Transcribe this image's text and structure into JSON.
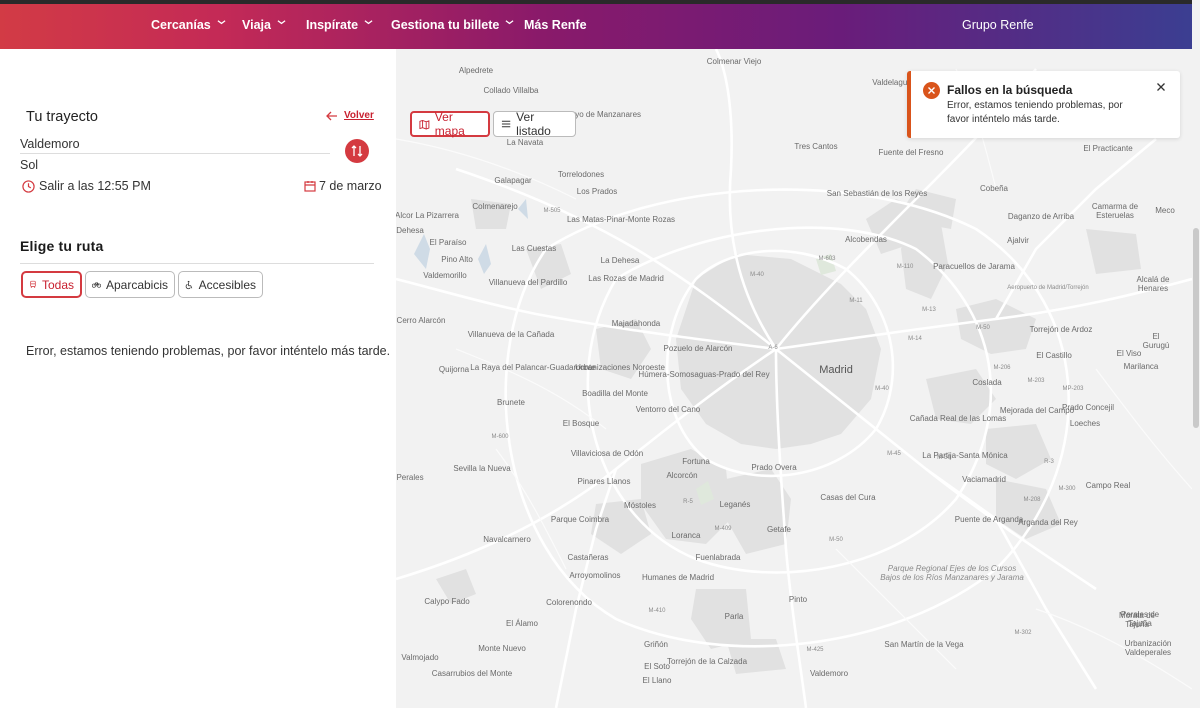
{
  "header": {
    "nav": [
      {
        "label": "Cercanías",
        "chevron": true
      },
      {
        "label": "Viaja",
        "chevron": true
      },
      {
        "label": "Inspírate",
        "chevron": true
      },
      {
        "label": "Gestiona tu billete",
        "chevron": true
      },
      {
        "label": "Más Renfe",
        "chevron": false
      }
    ],
    "right_link": "Grupo Renfe"
  },
  "journey": {
    "title": "Tu trayecto",
    "back_label": "Volver",
    "origin": "Valdemoro",
    "destination": "Sol",
    "departure": "Salir a las 12:55 PM",
    "date": "7 de marzo"
  },
  "routes": {
    "title": "Elige tu ruta",
    "filters": [
      {
        "label": "Todas",
        "active": true,
        "icon": "train-icon"
      },
      {
        "label": "Aparcabicis",
        "active": false,
        "icon": "bicycle-icon"
      },
      {
        "label": "Accesibles",
        "active": false,
        "icon": "wheelchair-icon"
      }
    ],
    "error": "Error, estamos teniendo problemas, por favor inténtelo más tarde."
  },
  "map": {
    "view_map": "Ver mapa",
    "view_list": "Ver listado",
    "places": [
      "Alpedrete",
      "Collado Villalba",
      "Hoyo de Manzanares",
      "Colmenar Viejo",
      "Valdelagua",
      "Tres Cantos",
      "La Navata",
      "Galapagar",
      "Torrelodones",
      "Los Prados",
      "Colmenarejo",
      "Fuente del Fresno",
      "El Practicante",
      "Cobeña",
      "San Sebastián de los Reyes",
      "Alcobendas",
      "Camarma de Esteruelas",
      "Meco",
      "Daganzo de Arriba",
      "Ajalvir",
      "Alcor La Pizarrera",
      "Dehesa",
      "El Paraíso",
      "Las Matas-Pinar-Monte Rozas",
      "Las Cuestas",
      "Pino Alto",
      "La Dehesa",
      "Paracuellos de Jarama",
      "Aeropuerto de Madrid/Torrejón",
      "Alcalá de Henares",
      "Valdemorillo",
      "Villanueva del Pardillo",
      "Las Rozas de Madrid",
      "Cerro Alarcón",
      "Villanueva de la Cañada",
      "Majadahonda",
      "Torrejón de Ardoz",
      "El Gurugú",
      "Pozuelo de Alarcón",
      "El Castillo",
      "El Viso",
      "Marilanca",
      "Quijorna",
      "La Raya del Palancar-Guadamonte",
      "Urbanizaciones Noroeste",
      "Húmera-Somosaguas-Prado del Rey",
      "Madrid",
      "Coslada",
      "Boadilla del Monte",
      "Brunete",
      "Ventorro del Cano",
      "El Bosque",
      "Cañada Real de las Lomas",
      "Mejorada del Campo",
      "Prado Concejil",
      "Loeches",
      "Villaviciosa de Odón",
      "Fortuna",
      "La Partija-Santa Mónica",
      "Sevilla la Nueva",
      "Perales",
      "Pinares Llanos",
      "Alcorcón",
      "Prado Overa",
      "Vaciamadrid",
      "Campo Real",
      "Casas del Cura",
      "Móstoles",
      "Leganés",
      "Parque Coimbra",
      "Getafe",
      "Puente de Arganda",
      "Arganda del Rey",
      "Navalcarnero",
      "Loranca",
      "Fuenlabrada",
      "Castañeras",
      "Arroyomolinos",
      "Humanes de Madrid",
      "Parque Regional Ejes de los Cursos Bajos de los Ríos Manzanares y Jarama",
      "Calypo Fado",
      "Colorenondo",
      "Pinto",
      "Morata de Tajuña",
      "El Álamo",
      "Parla",
      "Perales de Tajuña",
      "Griñón",
      "San Martín de la Vega",
      "Monte Nuevo",
      "Valmojado",
      "El Soto",
      "Torrejón de la Calzada",
      "Casarrubios del Monte",
      "El Llano",
      "Valdemoro",
      "Urbanización Valdeperales"
    ],
    "roads": [
      "M-505",
      "M-603",
      "M-110",
      "M-40",
      "M-11",
      "M-13",
      "M-50",
      "M-14",
      "M-206",
      "M-203",
      "MP-203",
      "A-6",
      "M-40",
      "M-45",
      "M-30",
      "M-600",
      "R-3",
      "M-208",
      "M-300",
      "R-5",
      "M-409",
      "M-50",
      "M-410",
      "M-425",
      "M-302"
    ]
  },
  "toast": {
    "title": "Fallos en la búsqueda",
    "body": "Error, estamos teniendo problemas, por favor inténtelo más tarde.",
    "accent": "#d9541b"
  },
  "colors": {
    "brand": "#d43a40",
    "accent_text": "#c8202f"
  }
}
